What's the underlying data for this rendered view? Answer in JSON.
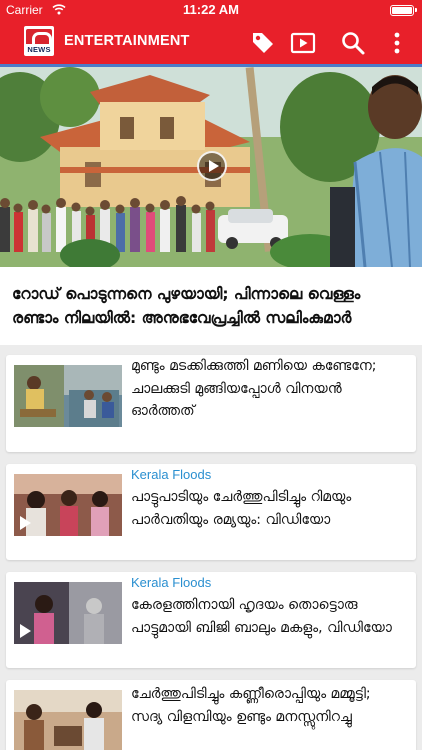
{
  "status_bar": {
    "carrier": "Carrier",
    "time": "11:22 AM"
  },
  "app_bar": {
    "logo_text": "NEWS",
    "title": "ENTERTAINMENT",
    "colors": {
      "bar": "#e8202a",
      "strip": "#4b7cc8"
    }
  },
  "hero": {
    "headline": "റോഡ് പൊടുന്നനെ പുഴയായി; പിന്നാലെ വെള്ളം രണ്ടാം നിലയിൽ: അനുഭവേപ്രച്ചിൽ സലിംകുമാർ"
  },
  "articles": [
    {
      "tag": "",
      "title": "മുണ്ടും മടക്കിക്കുത്തി മണിയെ കണ്ടേനേ; ചാലക്കുടി മുങ്ങിയപ്പോൾ വിനയൻ ഓർത്തത്",
      "has_video": false
    },
    {
      "tag": "Kerala Floods",
      "title": "പാട്ടുപാടിയും ചേർത്തുപിടിച്ചും റിമയും പാർവതിയും രമ്യയും: വിഡിയോ",
      "has_video": true
    },
    {
      "tag": "Kerala Floods",
      "title": "കേരളത്തിനായി ഹൃദയം തൊട്ടൊരു പാട്ടുമായി ബിജി ബാലും മകളും, വിഡിയോ",
      "has_video": true
    },
    {
      "tag": "",
      "title": "ചേർത്തുപിടിച്ചും കണ്ണീരൊപ്പിയും മമ്മൂട്ടി; സദ്യ വിളമ്പിയും ഉണ്ടും മനസ്സുനിറച്ചു",
      "has_video": false
    }
  ],
  "accent_tag_color": "#2a8fd0"
}
